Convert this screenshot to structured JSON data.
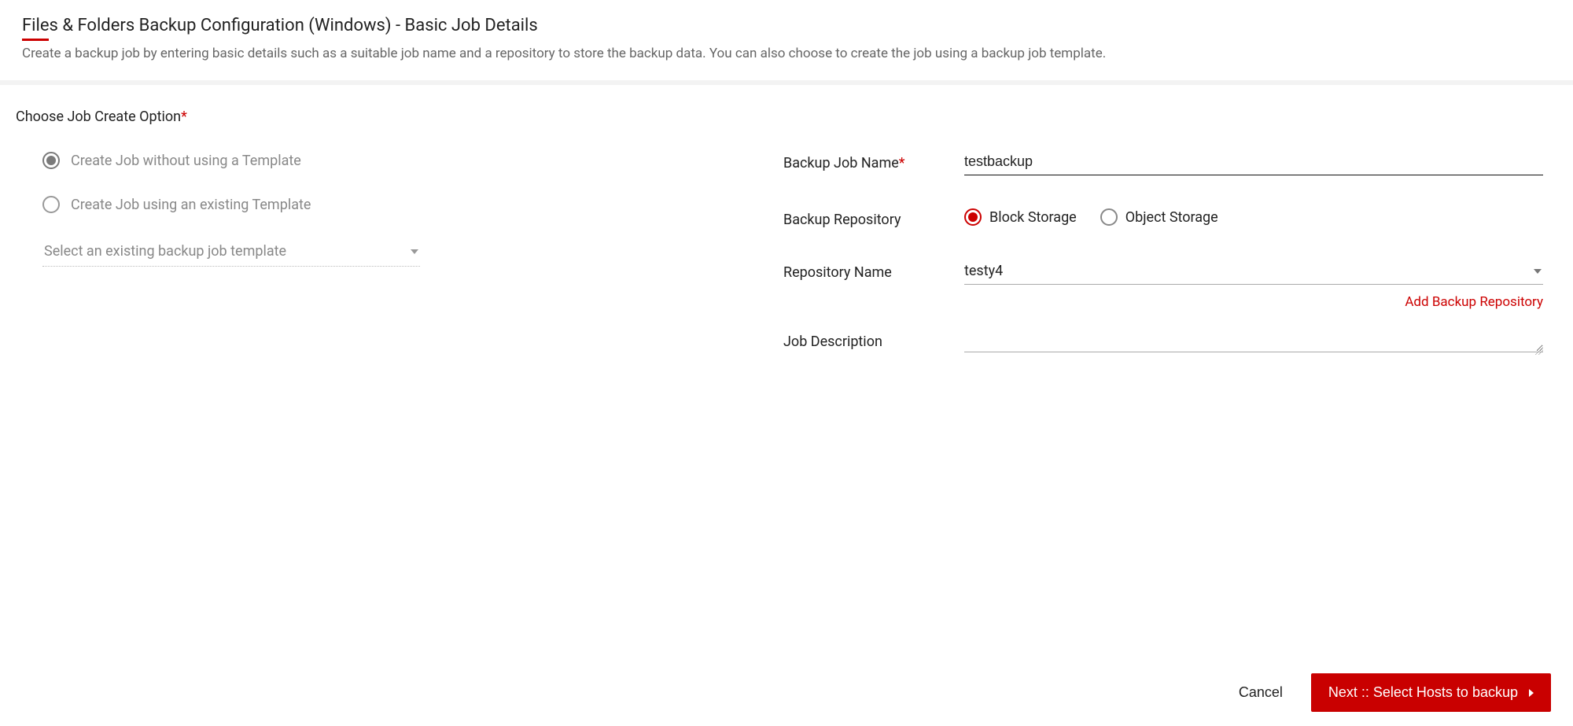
{
  "header": {
    "title": "Files & Folders Backup Configuration (Windows) - Basic Job Details",
    "subtitle": "Create a backup job by entering basic details such as a suitable job name and a repository to store the backup data. You can also choose to create the job using a backup job template."
  },
  "left": {
    "section_label": "Choose Job Create Option",
    "options": [
      {
        "label": "Create Job without using a Template",
        "selected": true
      },
      {
        "label": "Create Job using an existing Template",
        "selected": false
      }
    ],
    "template_placeholder": "Select an existing backup job template"
  },
  "right": {
    "job_name_label": "Backup Job Name",
    "job_name_value": "testbackup",
    "repo_label": "Backup Repository",
    "repo_options": [
      {
        "label": "Block Storage",
        "selected": true
      },
      {
        "label": "Object Storage",
        "selected": false
      }
    ],
    "repo_name_label": "Repository Name",
    "repo_name_value": "testy4",
    "add_repo_link": "Add Backup Repository",
    "desc_label": "Job Description",
    "desc_value": ""
  },
  "footer": {
    "cancel": "Cancel",
    "next": "Next :: Select Hosts to backup"
  }
}
